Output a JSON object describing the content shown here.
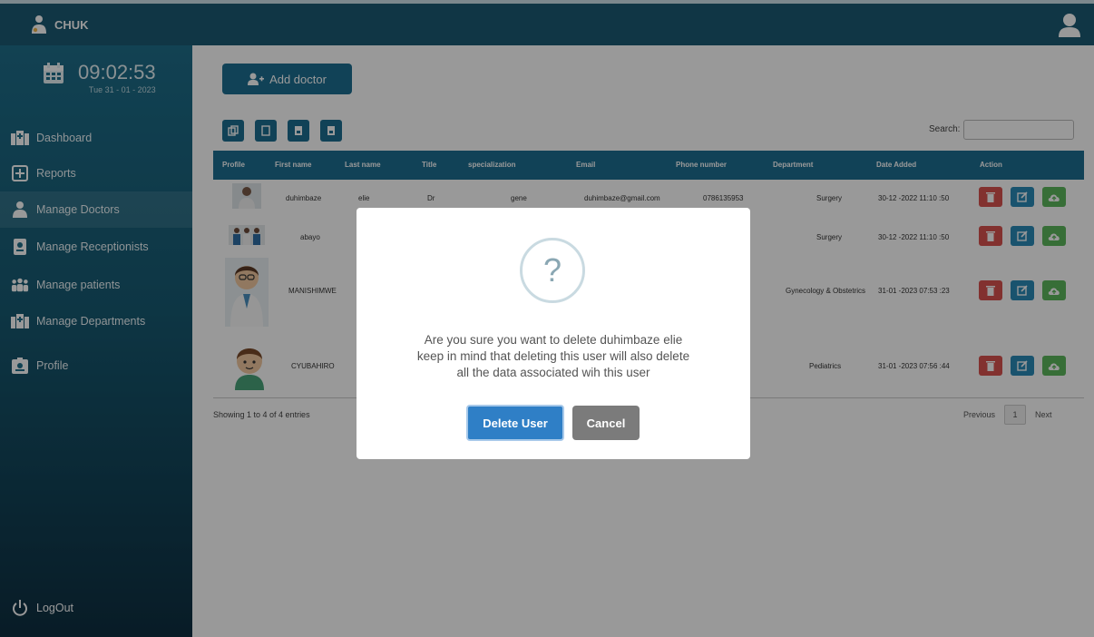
{
  "app": {
    "brand": "CHUK"
  },
  "clock": {
    "time": "09:02:53",
    "date": "Tue 31 - 01 - 2023"
  },
  "sidebar": {
    "items": [
      {
        "label": "Dashboard",
        "icon": "hospital-icon"
      },
      {
        "label": "Reports",
        "icon": "plus-box-icon"
      },
      {
        "label": "Manage Doctors",
        "icon": "doctor-icon"
      },
      {
        "label": "Manage Receptionists",
        "icon": "id-badge-icon"
      },
      {
        "label": "Manage patients",
        "icon": "people-icon"
      },
      {
        "label": "Manage Departments",
        "icon": "hospital-icon"
      },
      {
        "label": "Profile",
        "icon": "id-card-icon"
      }
    ],
    "active": "Manage Doctors",
    "logout": "LogOut"
  },
  "toolbar": {
    "add_label": "Add doctor",
    "search_label": "Search:"
  },
  "table": {
    "headers": [
      "Profile",
      "First name",
      "Last name",
      "Title",
      "specialization",
      "Email",
      "Phone number",
      "Department",
      "Date Added",
      "Action"
    ],
    "rows": [
      [
        "",
        "duhimbaze",
        "elie",
        "Dr",
        "gene",
        "duhimbaze@gmail.com",
        "0786135953",
        "Surgery",
        "30-12 -2022 11:10 :50"
      ],
      [
        "",
        "abayo",
        "",
        "",
        "",
        "",
        "",
        "Surgery",
        "30-12 -2022 11:10 :50"
      ],
      [
        "",
        "MANISHIMWE",
        "",
        "",
        "",
        "",
        "",
        "Gynecology & Obstetrics",
        "31-01 -2023 07:53 :23"
      ],
      [
        "",
        "CYUBAHIRO",
        "",
        "",
        "",
        "",
        "",
        "Pediatrics",
        "31-01 -2023 07:56 :44"
      ]
    ],
    "info": "Showing 1 to 4 of 4 entries",
    "pager": {
      "prev": "Previous",
      "page": "1",
      "next": "Next"
    }
  },
  "modal": {
    "icon": "question-icon",
    "icon_text": "?",
    "line1": "Are you sure you want to delete duhimbaze elie",
    "line2": "keep in mind that deleting this user will also delete",
    "line3": "all the data associated wih this user",
    "confirm": "Delete User",
    "cancel": "Cancel"
  },
  "colors": {
    "primary": "#1d6f92",
    "danger": "#d9534f",
    "info": "#2a8ab8",
    "success": "#5cb85c",
    "confirm": "#2f7fc6"
  }
}
